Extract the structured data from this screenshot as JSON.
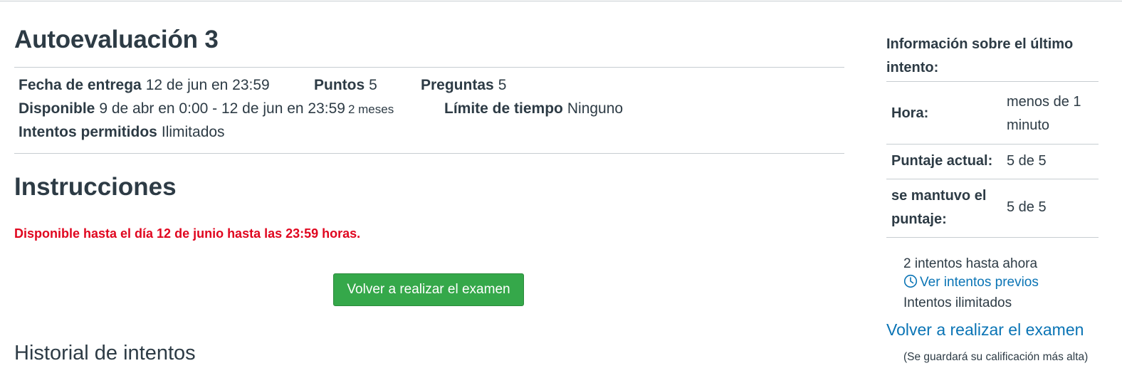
{
  "quiz": {
    "title": "Autoevaluación 3",
    "details": {
      "due_label": "Fecha de entrega",
      "due_value": "12 de jun en 23:59",
      "points_label": "Puntos",
      "points_value": "5",
      "questions_label": "Preguntas",
      "questions_value": "5",
      "available_label": "Disponible",
      "available_value": "9 de abr en 0:00 - 12 de jun en 23:59",
      "available_duration": "2 meses",
      "time_limit_label": "Límite de tiempo",
      "time_limit_value": "Ninguno",
      "attempts_label": "Intentos permitidos",
      "attempts_value": "Ilimitados"
    },
    "instructions_title": "Instrucciones",
    "instructions_text": "Disponible hasta el día 12 de junio hasta las 23:59 horas.",
    "retake_button": "Volver a realizar el examen",
    "history_title": "Historial de intentos",
    "colors": {
      "accent_green": "#35a84a",
      "alert_red": "#e0061f",
      "link_blue": "#0a74b5",
      "text": "#2d3b45"
    }
  },
  "sidebar": {
    "header": "Información sobre el último intento:",
    "rows": [
      {
        "key": "Hora:",
        "value": "menos de 1 minuto"
      },
      {
        "key": "Puntaje actual:",
        "value": "5 de 5"
      },
      {
        "key": "se mantuvo el puntaje:",
        "value": "5 de 5"
      }
    ],
    "attempts_so_far": "2 intentos hasta ahora",
    "view_previous": "Ver intentos previos",
    "view_previous_icon": "clock-icon",
    "unlimited": "Intentos ilimitados",
    "retake_link": "Volver a realizar el examen",
    "retake_note": "(Se guardará su calificación más alta)"
  }
}
